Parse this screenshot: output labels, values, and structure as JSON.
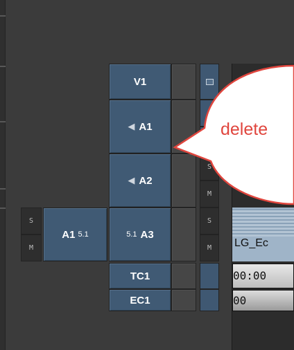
{
  "tracks": {
    "v1": "V1",
    "a1": "A1",
    "a2": "A2",
    "a3": "A3",
    "tc1": "TC1",
    "ec1": "EC1",
    "a3_prefix": "5.1",
    "source_a1": "A1",
    "source_a1_suffix": "5.1"
  },
  "buttons": {
    "solo": "S",
    "mute": "M"
  },
  "timeline": {
    "clip_label": "LG_Ec",
    "timecode": "00:00",
    "edgecode": "00"
  },
  "callout": {
    "text": "delete"
  },
  "colors": {
    "patch": "#405a74",
    "callout_text": "#e0463e"
  },
  "icons": [
    "speaker-icon",
    "monitor-icon"
  ]
}
